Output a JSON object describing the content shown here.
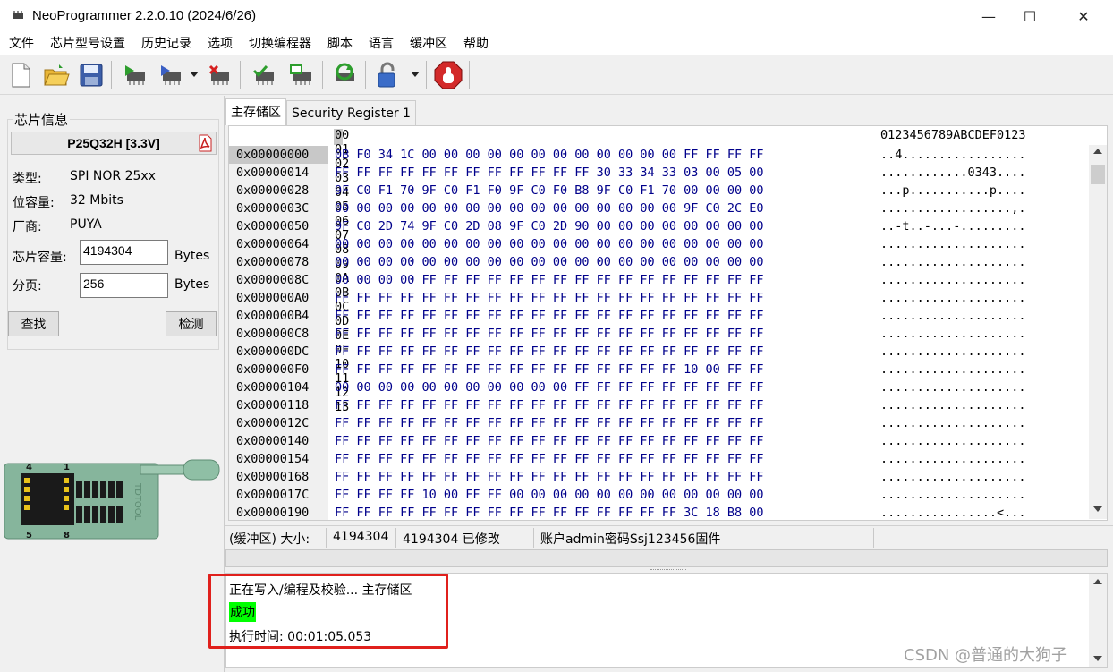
{
  "window": {
    "title": "NeoProgrammer 2.2.0.10 (2024/6/26)",
    "minimize": "—",
    "maximize": "☐",
    "close": "✕"
  },
  "menu": [
    "文件",
    "芯片型号设置",
    "历史记录",
    "选项",
    "切换编程器",
    "脚本",
    "语言",
    "缓冲区",
    "帮助"
  ],
  "toolbar": {
    "icons": [
      "new-file-icon",
      "open-folder-icon",
      "save-icon",
      "read-chip-icon",
      "write-chip-icon",
      "erase-chip-icon",
      "verify-icon",
      "blank-check-icon",
      "auto-icon",
      "lock-icon",
      "stop-icon"
    ]
  },
  "chip_info": {
    "group_title": "芯片信息",
    "name": "P25Q32H [3.3V]",
    "type_label": "类型:",
    "type_value": "SPI NOR 25xx",
    "capacity_label": "位容量:",
    "capacity_value": "32 Mbits",
    "vendor_label": "厂商:",
    "vendor_value": "PUYA",
    "size_label": "芯片容量:",
    "size_value": "4194304",
    "size_unit": "Bytes",
    "page_label": "分页:",
    "page_value": "256",
    "page_unit": "Bytes",
    "find_button": "查找",
    "detect_button": "检测"
  },
  "socket": {
    "pin4": "4",
    "pin1": "1",
    "pin5": "5",
    "pin8": "8",
    "brand": "TDTOOL"
  },
  "tabs": [
    "主存储区",
    "Security Register 1"
  ],
  "hex": {
    "header_bytes": "00 01 02 03 04 05 06 07 08 09 0A 0B 0C 0D 0E 0F 10 11 12 13",
    "header_ascii": "0123456789ABCDEF0123",
    "rows": [
      {
        "addr": "0x00000000",
        "bytes": "0B F0 34 1C 00 00 00 00 00 00 00 00 00 00 00 00 FF FF FF FF",
        "ascii": "..4................."
      },
      {
        "addr": "0x00000014",
        "bytes": "FF FF FF FF FF FF FF FF FF FF FF FF 30 33 34 33 03 00 05 00",
        "ascii": "............0343...."
      },
      {
        "addr": "0x00000028",
        "bytes": "9F C0 F1 70 9F C0 F1 F0 9F C0 F0 B8 9F C0 F1 70 00 00 00 00",
        "ascii": "...p...........p...."
      },
      {
        "addr": "0x0000003C",
        "bytes": "00 00 00 00 00 00 00 00 00 00 00 00 00 00 00 00 9F C0 2C E0",
        "ascii": "..................,."
      },
      {
        "addr": "0x00000050",
        "bytes": "9F C0 2D 74 9F C0 2D 08 9F C0 2D 90 00 00 00 00 00 00 00 00",
        "ascii": "..-t..-...-........."
      },
      {
        "addr": "0x00000064",
        "bytes": "00 00 00 00 00 00 00 00 00 00 00 00 00 00 00 00 00 00 00 00",
        "ascii": "...................."
      },
      {
        "addr": "0x00000078",
        "bytes": "00 00 00 00 00 00 00 00 00 00 00 00 00 00 00 00 00 00 00 00",
        "ascii": "...................."
      },
      {
        "addr": "0x0000008C",
        "bytes": "00 00 00 00 FF FF FF FF FF FF FF FF FF FF FF FF FF FF FF FF",
        "ascii": "...................."
      },
      {
        "addr": "0x000000A0",
        "bytes": "FF FF FF FF FF FF FF FF FF FF FF FF FF FF FF FF FF FF FF FF",
        "ascii": "...................."
      },
      {
        "addr": "0x000000B4",
        "bytes": "FF FF FF FF FF FF FF FF FF FF FF FF FF FF FF FF FF FF FF FF",
        "ascii": "...................."
      },
      {
        "addr": "0x000000C8",
        "bytes": "FF FF FF FF FF FF FF FF FF FF FF FF FF FF FF FF FF FF FF FF",
        "ascii": "...................."
      },
      {
        "addr": "0x000000DC",
        "bytes": "FF FF FF FF FF FF FF FF FF FF FF FF FF FF FF FF FF FF FF FF",
        "ascii": "...................."
      },
      {
        "addr": "0x000000F0",
        "bytes": "FF FF FF FF FF FF FF FF FF FF FF FF FF FF FF FF 10 00 FF FF",
        "ascii": "...................."
      },
      {
        "addr": "0x00000104",
        "bytes": "00 00 00 00 00 00 00 00 00 00 00 FF FF FF FF FF FF FF FF FF",
        "ascii": "...................."
      },
      {
        "addr": "0x00000118",
        "bytes": "FF FF FF FF FF FF FF FF FF FF FF FF FF FF FF FF FF FF FF FF",
        "ascii": "...................."
      },
      {
        "addr": "0x0000012C",
        "bytes": "FF FF FF FF FF FF FF FF FF FF FF FF FF FF FF FF FF FF FF FF",
        "ascii": "...................."
      },
      {
        "addr": "0x00000140",
        "bytes": "FF FF FF FF FF FF FF FF FF FF FF FF FF FF FF FF FF FF FF FF",
        "ascii": "...................."
      },
      {
        "addr": "0x00000154",
        "bytes": "FF FF FF FF FF FF FF FF FF FF FF FF FF FF FF FF FF FF FF FF",
        "ascii": "...................."
      },
      {
        "addr": "0x00000168",
        "bytes": "FF FF FF FF FF FF FF FF FF FF FF FF FF FF FF FF FF FF FF FF",
        "ascii": "...................."
      },
      {
        "addr": "0x0000017C",
        "bytes": "FF FF FF FF 10 00 FF FF 00 00 00 00 00 00 00 00 00 00 00 00",
        "ascii": "...................."
      },
      {
        "addr": "0x00000190",
        "bytes": "FF FF FF FF FF FF FF FF FF FF FF FF FF FF FF FF 3C 18 B8 00",
        "ascii": "................<..."
      }
    ]
  },
  "status": {
    "buffer_label": "(缓冲区) 大小:",
    "buffer_size": "4194304",
    "modified": "4194304 已修改",
    "account": "账户admin密码Ssj123456固件"
  },
  "log": {
    "line1": "正在写入/编程及校验... 主存储区",
    "success": "成功",
    "line3": "执行时间:   00:01:05.053"
  },
  "watermark": "CSDN @普通的大狗子",
  "colors": {
    "hex_bytes": "#00008b",
    "success_bg": "#00ff00",
    "highlight_border": "#e0201c"
  }
}
